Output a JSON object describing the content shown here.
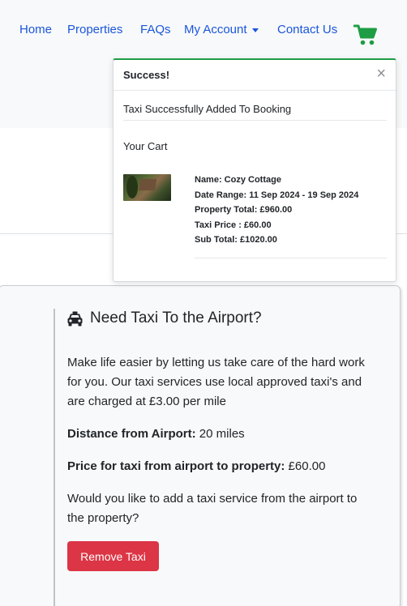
{
  "nav": {
    "home": "Home",
    "properties": "Properties",
    "faqs": "FAQs",
    "my_account": "My Account",
    "contact_us": "Contact Us",
    "cart_icon": "shopping-cart-icon"
  },
  "toast": {
    "title": "Success!",
    "close": "×",
    "message": "Taxi Successfully Added To Booking",
    "cart_title": "Your Cart",
    "item": {
      "name": "Name: Cozy Cottage",
      "date_range": "Date Range: 11 Sep 2024 - 19 Sep 2024",
      "property_total": "Property Total: £960.00",
      "taxi_price": "Taxi Price : £60.00",
      "sub_total": "Sub Total: £1020.00"
    }
  },
  "taxi": {
    "icon": "taxi-icon",
    "heading": "Need Taxi To the Airport?",
    "intro": "Make life easier by letting us take care of the hard work for you. Our taxi services use local approved taxi's and are charged at £3.00 per mile",
    "distance_label": "Distance from Airport:",
    "distance_value": " 20 miles",
    "price_label": "Price for taxi from airport to property:",
    "price_value": " £60.00",
    "question": "Would you like to add a taxi service from the airport to the property?",
    "remove_button": "Remove Taxi"
  },
  "colors": {
    "link": "#1a56db",
    "cart": "#1f9d44",
    "danger": "#dc3545"
  }
}
